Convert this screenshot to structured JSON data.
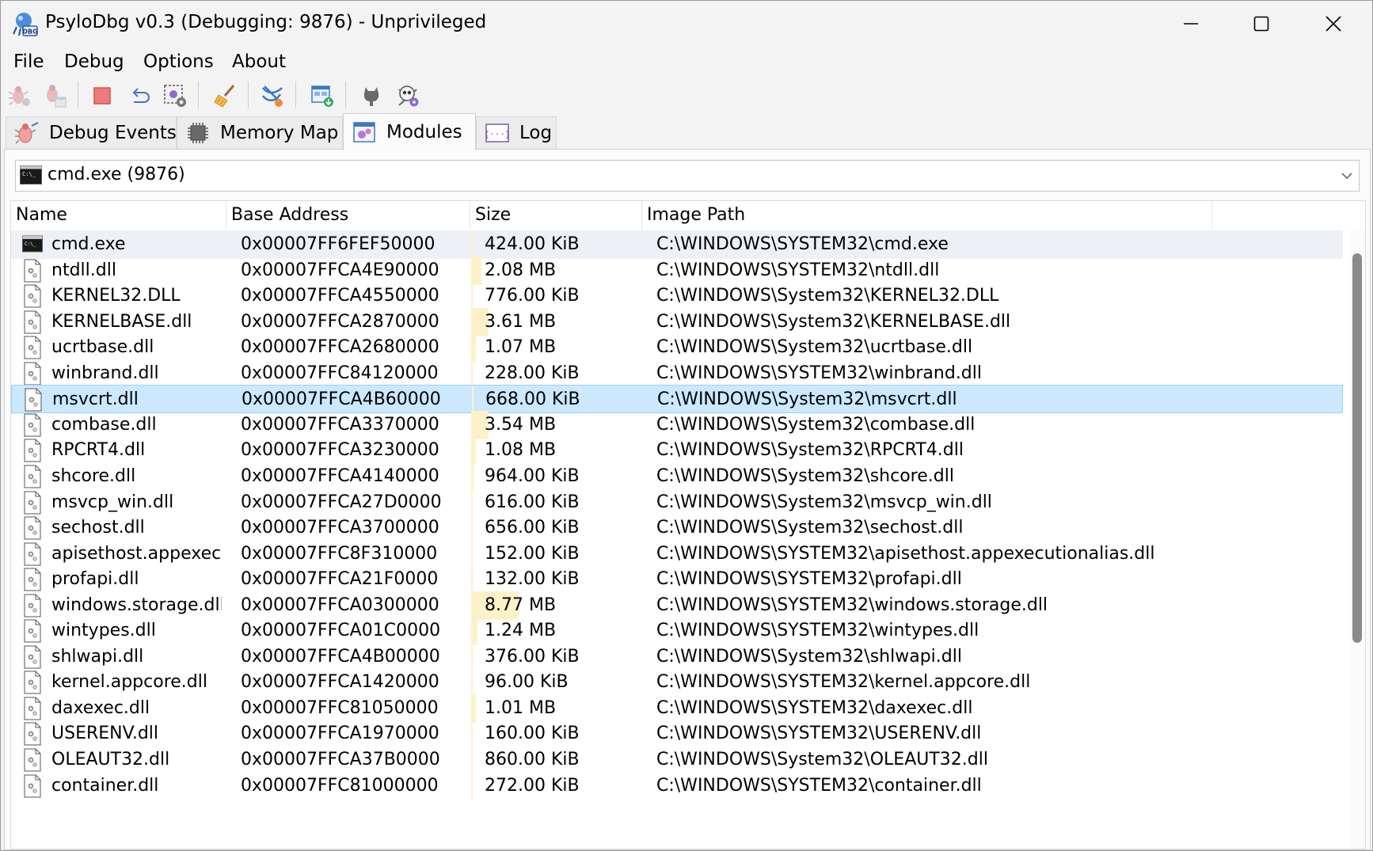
{
  "window": {
    "title": "PsyloDbg v0.3 (Debugging: 9876) - Unprivileged"
  },
  "menu": {
    "items": [
      {
        "label": "File"
      },
      {
        "label": "Debug"
      },
      {
        "label": "Options"
      },
      {
        "label": "About"
      }
    ]
  },
  "toolbar": {
    "buttons": [
      {
        "icon": "attach-bug-icon"
      },
      {
        "icon": "open-process-bug-icon"
      },
      {
        "icon": "stop-icon"
      },
      {
        "icon": "detach-undo-icon"
      },
      {
        "icon": "settings-select-icon"
      },
      {
        "icon": "clear-broom-icon"
      },
      {
        "icon": "network-filter-icon"
      },
      {
        "icon": "window-download-icon"
      },
      {
        "icon": "github-icon"
      },
      {
        "icon": "skull-settings-icon"
      }
    ]
  },
  "tabs": [
    {
      "label": "Debug Events",
      "icon": "bug-events-icon",
      "active": false
    },
    {
      "label": "Memory Map",
      "icon": "chip-icon",
      "active": false
    },
    {
      "label": "Modules",
      "icon": "modules-window-icon",
      "active": true
    },
    {
      "label": "Log",
      "icon": "log-console-icon",
      "active": false
    }
  ],
  "process_selector": {
    "value": "cmd.exe (9876)"
  },
  "table": {
    "columns": [
      "Name",
      "Base Address",
      "Size",
      "Image Path"
    ],
    "rows": [
      {
        "name": "cmd.exe",
        "base": "0x00007FF6FEF50000",
        "size": "424.00 KiB",
        "path": "C:\\WINDOWS\\SYSTEM32\\cmd.exe",
        "size_fraction": 0.005,
        "icon": "console-icon"
      },
      {
        "name": "ntdll.dll",
        "base": "0x00007FFCA4E90000",
        "size": "2.08 MB",
        "path": "C:\\WINDOWS\\SYSTEM32\\ntdll.dll",
        "size_fraction": 0.06,
        "icon": "dll-file-icon"
      },
      {
        "name": "KERNEL32.DLL",
        "base": "0x00007FFCA4550000",
        "size": "776.00 KiB",
        "path": "C:\\WINDOWS\\System32\\KERNEL32.DLL",
        "size_fraction": 0.01,
        "icon": "dll-file-icon"
      },
      {
        "name": "KERNELBASE.dll",
        "base": "0x00007FFCA2870000",
        "size": "3.61 MB",
        "path": "C:\\WINDOWS\\System32\\KERNELBASE.dll",
        "size_fraction": 0.1,
        "icon": "dll-file-icon"
      },
      {
        "name": "ucrtbase.dll",
        "base": "0x00007FFCA2680000",
        "size": "1.07 MB",
        "path": "C:\\WINDOWS\\System32\\ucrtbase.dll",
        "size_fraction": 0.03,
        "icon": "dll-file-icon"
      },
      {
        "name": "winbrand.dll",
        "base": "0x00007FFC84120000",
        "size": "228.00 KiB",
        "path": "C:\\WINDOWS\\SYSTEM32\\winbrand.dll",
        "size_fraction": 0.004,
        "icon": "dll-file-icon"
      },
      {
        "name": "msvcrt.dll",
        "base": "0x00007FFCA4B60000",
        "size": "668.00 KiB",
        "path": "C:\\WINDOWS\\System32\\msvcrt.dll",
        "size_fraction": 0.008,
        "icon": "dll-file-icon",
        "selected": true
      },
      {
        "name": "combase.dll",
        "base": "0x00007FFCA3370000",
        "size": "3.54 MB",
        "path": "C:\\WINDOWS\\System32\\combase.dll",
        "size_fraction": 0.1,
        "icon": "dll-file-icon"
      },
      {
        "name": "RPCRT4.dll",
        "base": "0x00007FFCA3230000",
        "size": "1.08 MB",
        "path": "C:\\WINDOWS\\System32\\RPCRT4.dll",
        "size_fraction": 0.03,
        "icon": "dll-file-icon"
      },
      {
        "name": "shcore.dll",
        "base": "0x00007FFCA4140000",
        "size": "964.00 KiB",
        "path": "C:\\WINDOWS\\System32\\shcore.dll",
        "size_fraction": 0.012,
        "icon": "dll-file-icon"
      },
      {
        "name": "msvcp_win.dll",
        "base": "0x00007FFCA27D0000",
        "size": "616.00 KiB",
        "path": "C:\\WINDOWS\\System32\\msvcp_win.dll",
        "size_fraction": 0.008,
        "icon": "dll-file-icon"
      },
      {
        "name": "sechost.dll",
        "base": "0x00007FFCA3700000",
        "size": "656.00 KiB",
        "path": "C:\\WINDOWS\\System32\\sechost.dll",
        "size_fraction": 0.008,
        "icon": "dll-file-icon"
      },
      {
        "name": "apisethost.appexecu...",
        "base": "0x00007FFC8F310000",
        "size": "152.00 KiB",
        "path": "C:\\WINDOWS\\SYSTEM32\\apisethost.appexecutionalias.dll",
        "size_fraction": 0.003,
        "icon": "dll-file-icon"
      },
      {
        "name": "profapi.dll",
        "base": "0x00007FFCA21F0000",
        "size": "132.00 KiB",
        "path": "C:\\WINDOWS\\SYSTEM32\\profapi.dll",
        "size_fraction": 0.003,
        "icon": "dll-file-icon"
      },
      {
        "name": "windows.storage.dll",
        "base": "0x00007FFCA0300000",
        "size": "8.77 MB",
        "path": "C:\\WINDOWS\\SYSTEM32\\windows.storage.dll",
        "size_fraction": 0.28,
        "icon": "dll-file-icon"
      },
      {
        "name": "wintypes.dll",
        "base": "0x00007FFCA01C0000",
        "size": "1.24 MB",
        "path": "C:\\WINDOWS\\SYSTEM32\\wintypes.dll",
        "size_fraction": 0.035,
        "icon": "dll-file-icon"
      },
      {
        "name": "shlwapi.dll",
        "base": "0x00007FFCA4B00000",
        "size": "376.00 KiB",
        "path": "C:\\WINDOWS\\System32\\shlwapi.dll",
        "size_fraction": 0.005,
        "icon": "dll-file-icon"
      },
      {
        "name": "kernel.appcore.dll",
        "base": "0x00007FFCA1420000",
        "size": "96.00 KiB",
        "path": "C:\\WINDOWS\\SYSTEM32\\kernel.appcore.dll",
        "size_fraction": 0.002,
        "icon": "dll-file-icon"
      },
      {
        "name": "daxexec.dll",
        "base": "0x00007FFC81050000",
        "size": "1.01 MB",
        "path": "C:\\WINDOWS\\SYSTEM32\\daxexec.dll",
        "size_fraction": 0.03,
        "icon": "dll-file-icon"
      },
      {
        "name": "USERENV.dll",
        "base": "0x00007FFCA1970000",
        "size": "160.00 KiB",
        "path": "C:\\WINDOWS\\SYSTEM32\\USERENV.dll",
        "size_fraction": 0.003,
        "icon": "dll-file-icon"
      },
      {
        "name": "OLEAUT32.dll",
        "base": "0x00007FFCA37B0000",
        "size": "860.00 KiB",
        "path": "C:\\WINDOWS\\System32\\OLEAUT32.dll",
        "size_fraction": 0.01,
        "icon": "dll-file-icon"
      },
      {
        "name": "container.dll",
        "base": "0x00007FFC81000000",
        "size": "272.00 KiB",
        "path": "C:\\WINDOWS\\SYSTEM32\\container.dll",
        "size_fraction": 0.004,
        "icon": "dll-file-icon"
      }
    ]
  },
  "colors": {
    "selection": "#cce8ff",
    "size_bar": "#fdf1c8"
  }
}
